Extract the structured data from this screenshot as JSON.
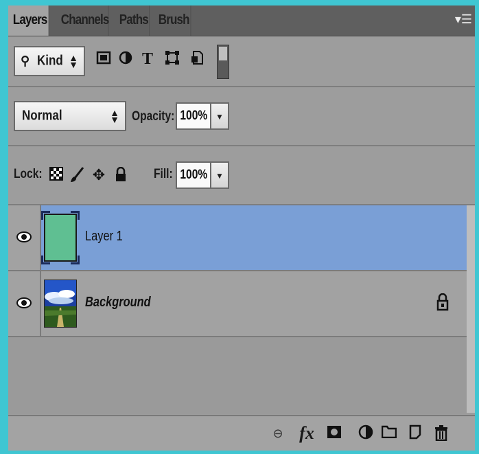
{
  "tabs": [
    "Layers",
    "Channels",
    "Paths",
    "Brush"
  ],
  "panel_menu_icon": "panel-menu-icon",
  "filter": {
    "kind_label": "Kind",
    "icons": [
      "search-icon",
      "pixel-filter-icon",
      "adjustment-filter-icon",
      "type-filter-icon",
      "shape-filter-icon",
      "smart-object-filter-icon",
      "filter-toggle-icon"
    ]
  },
  "blend": {
    "mode": "Normal",
    "opacity_label": "Opacity:",
    "opacity_value": "100%"
  },
  "lock": {
    "label": "Lock:",
    "icons": [
      "lock-transparent-icon",
      "lock-image-icon",
      "lock-position-icon",
      "lock-all-icon"
    ],
    "fill_label": "Fill:",
    "fill_value": "100%"
  },
  "layers": [
    {
      "name": "Layer 1",
      "selected": true,
      "thumb_color": "#5fbf92"
    },
    {
      "name": "Background",
      "selected": false,
      "locked": true
    }
  ],
  "bottom_icons": [
    "link-layers-icon",
    "fx-icon",
    "layer-mask-icon",
    "adjustment-layer-icon",
    "new-group-icon",
    "new-layer-icon",
    "trash-icon"
  ],
  "colors": {
    "selected_row": "#7a9fd6",
    "panel_bg": "#9d9d9d",
    "tab_bar": "#5f5f5f",
    "frame": "#3fc6d2"
  }
}
